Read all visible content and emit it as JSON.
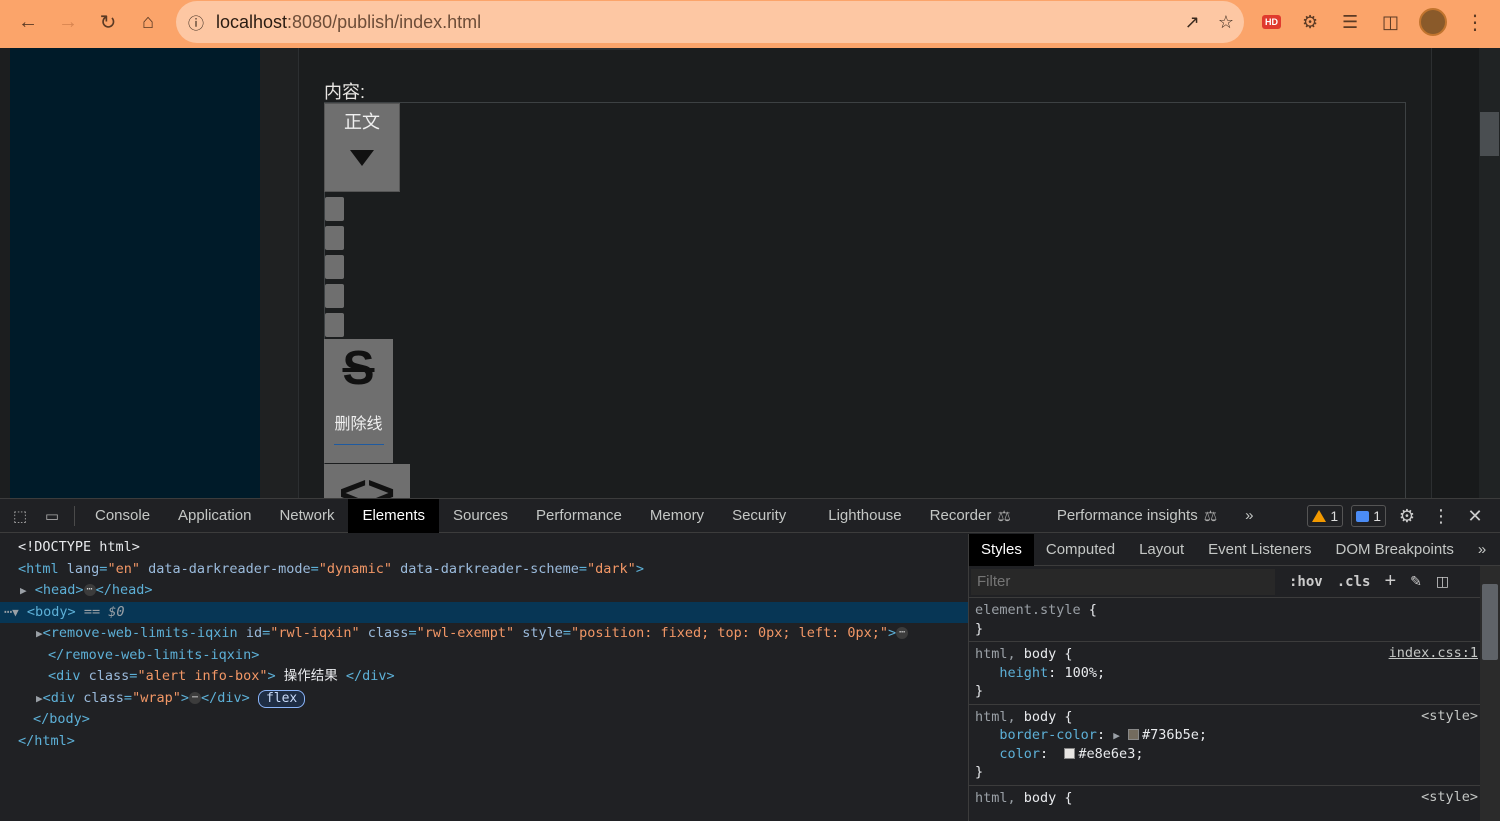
{
  "browser": {
    "url_host": "localhost",
    "url_rest": ":8080/publish/index.html",
    "ext_badge": "HD"
  },
  "page": {
    "content_label": "内容:",
    "format_button": "正文",
    "strike_icon": "S",
    "strike_label": "删除线",
    "code_icon": "<>"
  },
  "devtools": {
    "tabs": [
      "Console",
      "Application",
      "Network",
      "Elements",
      "Sources",
      "Performance",
      "Memory",
      "Security",
      "Lighthouse",
      "Recorder",
      "Performance insights"
    ],
    "active_tab": "Elements",
    "warnings_count": "1",
    "messages_count": "1",
    "more_tabs": "»",
    "dom": {
      "doctype": "<!DOCTYPE html>",
      "html_open": "<html",
      "html_lang_attr": "lang",
      "html_lang_val": "\"en\"",
      "dr_mode_attr": "data-darkreader-mode",
      "dr_mode_val": "\"dynamic\"",
      "dr_scheme_attr": "data-darkreader-scheme",
      "dr_scheme_val": "\"dark\"",
      "head_open": "<head>",
      "head_close": "</head>",
      "body_open": "<body>",
      "body_marker": " == $0",
      "rwl_open": "<remove-web-limits-iqxin",
      "rwl_id_attr": "id",
      "rwl_id_val": "\"rwl-iqxin\"",
      "rwl_class_attr": "class",
      "rwl_class_val": "\"rwl-exempt\"",
      "rwl_style_attr": "style",
      "rwl_style_val": "\"position: fixed; top: 0px; left: 0px;\"",
      "rwl_close": "</remove-web-limits-iqxin>",
      "alert_open": "<div",
      "alert_class_attr": "class",
      "alert_class_val": "\"alert info-box\"",
      "alert_text": " 操作结果 ",
      "div_close": "</div>",
      "wrap_class_val": "\"wrap\"",
      "flex_badge": "flex",
      "body_close": "</body>",
      "html_close": "</html>"
    },
    "styles": {
      "tabs": [
        "Styles",
        "Computed",
        "Layout",
        "Event Listeners",
        "DOM Breakpoints"
      ],
      "active_tab": "Styles",
      "filter_placeholder": "Filter",
      "hov": ":hov",
      "cls": ".cls",
      "rules": [
        {
          "selector_dim": "element.style",
          "selector": "",
          "source": "",
          "props": []
        },
        {
          "selector_dim": "html, ",
          "selector": "body",
          "source": "index.css:1",
          "props": [
            {
              "name": "height",
              "value": "100%;"
            }
          ]
        },
        {
          "selector_dim": "html, ",
          "selector": "body",
          "source": "<style>",
          "props": [
            {
              "name": "border-color",
              "value": "#736b5e;",
              "swatch": "#736b5e"
            },
            {
              "name": "color",
              "value": "#e8e6e3;",
              "swatch": "#e8e6e3"
            }
          ]
        },
        {
          "selector_dim": "html, ",
          "selector": "body",
          "source": "<style>",
          "props": []
        }
      ]
    }
  }
}
